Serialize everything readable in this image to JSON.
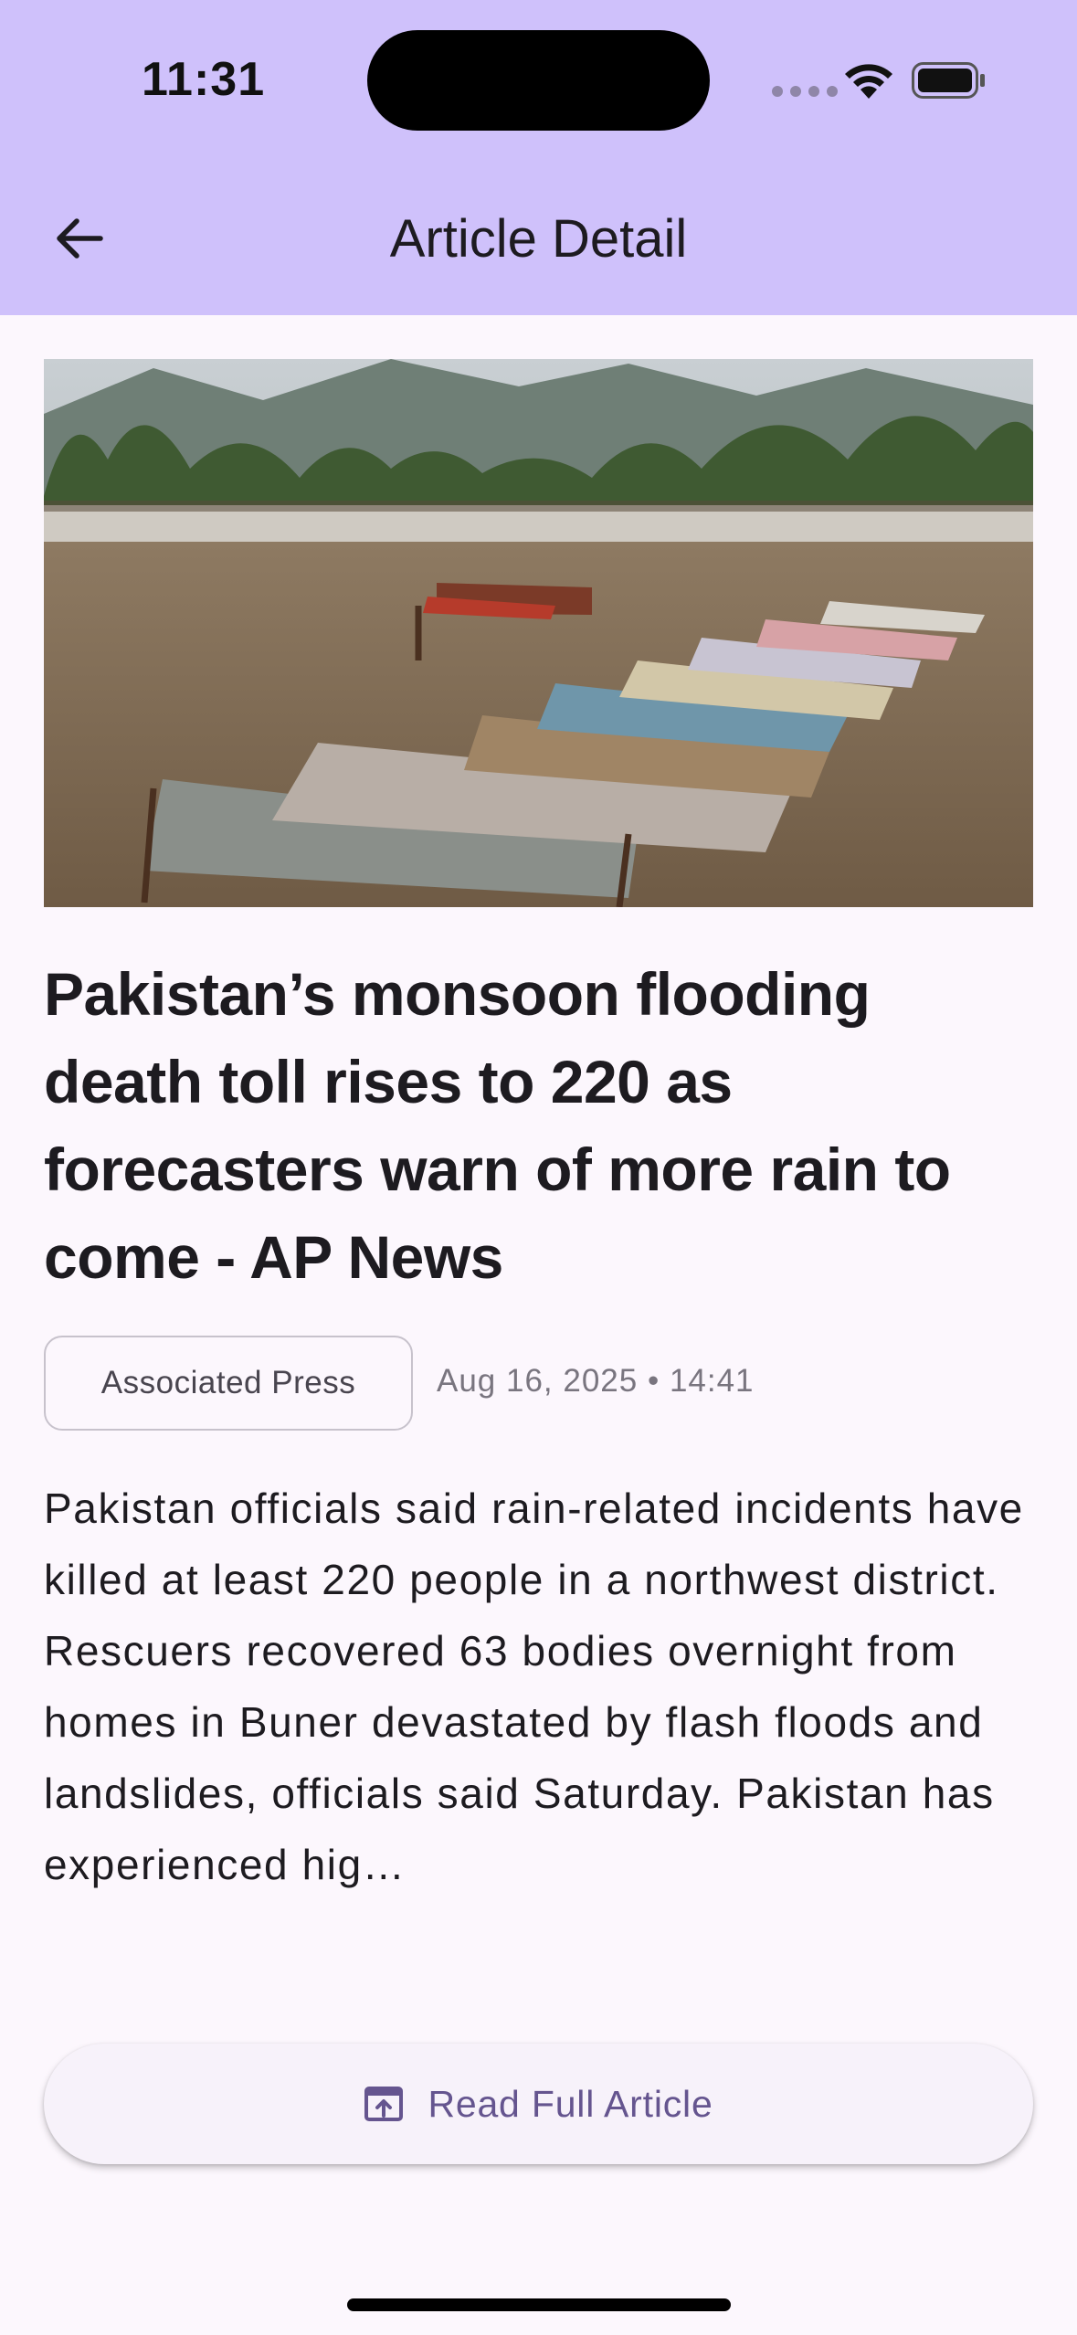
{
  "status_bar": {
    "time": "11:31"
  },
  "app_bar": {
    "title": "Article Detail",
    "back_icon": "arrow-back-icon"
  },
  "article": {
    "image_alt": "Funeral prayers for flood victims in a field",
    "headline": "Pakistan’s monsoon flooding death toll rises to 220 as forecasters warn of more rain to come - AP News",
    "source": "Associated Press",
    "date": "Aug 16, 2025 • 14:41",
    "summary": "Pakistan officials said rain-related incidents have killed at least 220 people in a northwest district. Rescuers recovered 63 bodies overnight from homes in Buner devastated by flash floods and landslides, officials said Saturday. Pakistan has experienced hig…"
  },
  "actions": {
    "read_full_label": "Read Full Article",
    "read_full_icon": "open-in-browser-icon"
  },
  "colors": {
    "app_bar_bg": "#cfc1fb",
    "page_bg": "#fcf7fd",
    "accent": "#65558f"
  }
}
